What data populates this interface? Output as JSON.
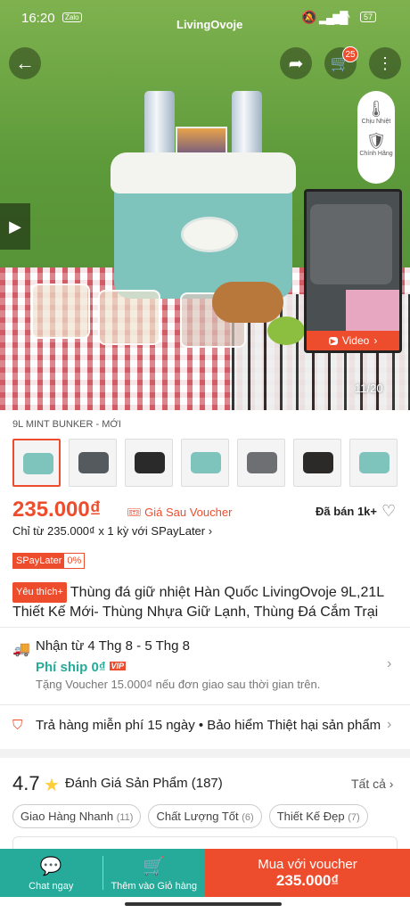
{
  "status": {
    "time": "16:20",
    "battery": "57",
    "zalo": "Zalo"
  },
  "header": {
    "brand": "LivingOvoje",
    "cart_count": "25"
  },
  "gallery": {
    "counter": "11/20",
    "video_label": "Video",
    "panel_items": [
      "Chịu Nhiệt",
      "Chính Hãng"
    ]
  },
  "variant": {
    "label": "9L MINT BUNKER - MỚI",
    "thumb_colors": [
      "#7fc3bd",
      "#555a5e",
      "#2a2a2a",
      "#7fc3bd",
      "#6d6f72",
      "#2b2a28",
      "#7fc3bd"
    ]
  },
  "price": {
    "value": "235.000₫",
    "sub": "Giá Sau Voucher",
    "sold": "Đã bán 1k+",
    "spaylater": "Chỉ từ 235.000₫ x 1 kỳ với SPayLater"
  },
  "spay_tag": {
    "label": "SPayLater",
    "rate": "0%"
  },
  "product": {
    "fav": "Yêu thích+",
    "title": "Thùng đá giữ nhiệt Hàn Quốc LivingOvoje 9L,21L Thiết Kế Mới- Thùng Nhựa Giữ Lạnh, Thùng Đá Cắm Trại"
  },
  "shipping": {
    "eta": "Nhận từ 4 Thg 8 - 5 Thg 8",
    "fee": "Phí ship 0₫",
    "vip": "VIP",
    "voucher": "Tặng Voucher 15.000₫ nếu đơn giao sau thời gian trên."
  },
  "returns": {
    "text": "Trả hàng miễn phí 15 ngày • Bảo hiểm Thiệt hại sản phẩm"
  },
  "reviews": {
    "score": "4.7",
    "title": "Đánh Giá Sản Phẩm",
    "count": "(187)",
    "see_all": "Tất cả",
    "chips": [
      {
        "label": "Giao Hàng Nhanh",
        "count": "(11)"
      },
      {
        "label": "Chất Lượng Tốt",
        "count": "(6)"
      },
      {
        "label": "Thiết Kế Đẹp",
        "count": "(7)"
      }
    ]
  },
  "bottom": {
    "chat": "Chat ngay",
    "add_cart": "Thêm vào Giỏ hàng",
    "buy_line1": "Mua với voucher",
    "buy_line2": "235.000₫"
  }
}
